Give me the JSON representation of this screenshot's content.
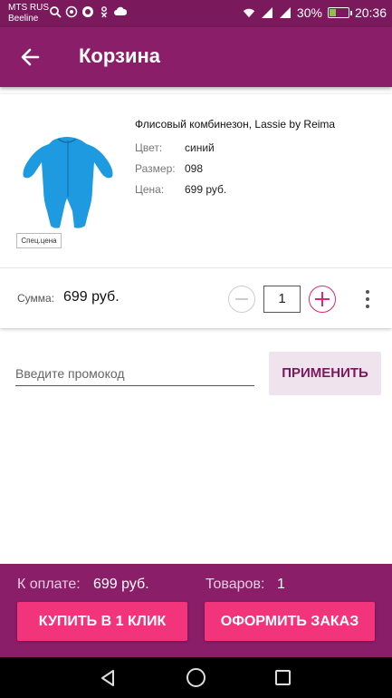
{
  "status_bar": {
    "carrier_1": "MTS RUS",
    "carrier_2": "Beeline",
    "battery_percent": "30%",
    "battery_level": 0.3,
    "time": "20:36"
  },
  "app_bar": {
    "title": "Корзина"
  },
  "cart_item": {
    "name": "Флисовый комбинезон, Lassie by Reima",
    "color_label": "Цвет:",
    "color_value": "синий",
    "size_label": "Размер:",
    "size_value": "098",
    "price_label": "Цена:",
    "price_value": "699 руб.",
    "badge": "Спец.цена",
    "sum_label": "Сумма:",
    "sum_value": "699 руб.",
    "quantity": "1"
  },
  "promo": {
    "placeholder": "Введите промокод",
    "apply_label": "ПРИМЕНИТЬ"
  },
  "footer": {
    "pay_label": "К оплате:",
    "pay_value": "699 руб.",
    "items_label": "Товаров:",
    "items_value": "1",
    "buy_one_click_label": "КУПИТЬ В 1 КЛИК",
    "checkout_label": "ОФОРМИТЬ ЗАКАЗ"
  },
  "colors": {
    "primary": "#8b1e69",
    "status_bar": "#7a1a5c",
    "accent": "#f2357a",
    "product": "#1e9be0"
  }
}
